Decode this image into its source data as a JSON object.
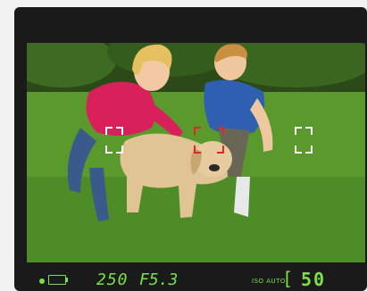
{
  "viewfinder": {
    "af_points": [
      {
        "name": "left",
        "active": false
      },
      {
        "name": "center",
        "active": true
      },
      {
        "name": "right",
        "active": false
      }
    ],
    "info": {
      "shutter_speed": "250",
      "aperture": "F5.3",
      "iso_label": "ISO AUTO",
      "frames_remaining": "50",
      "focus_confirm": true,
      "battery_icon": "battery-icon"
    },
    "colors": {
      "info_text": "#79e04a",
      "af_active": "#e02828",
      "af_inactive": "#ffffff"
    }
  }
}
